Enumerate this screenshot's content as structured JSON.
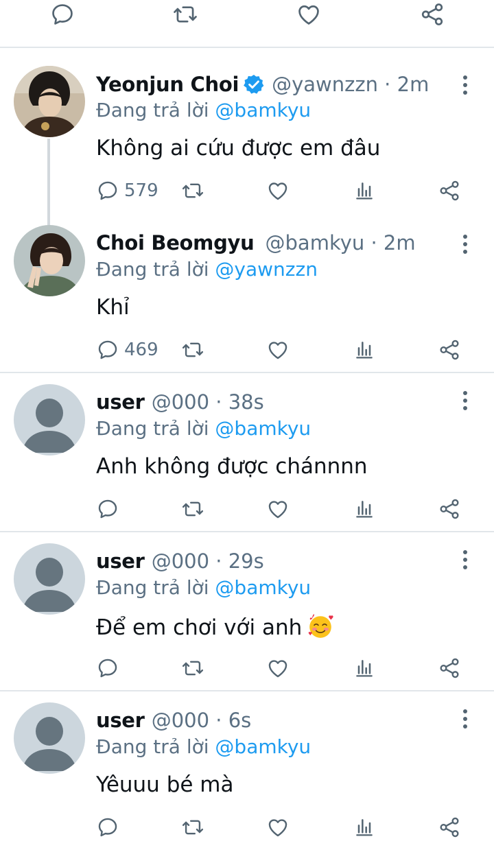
{
  "top_actions": [
    "reply-icon",
    "retweet-icon",
    "like-icon",
    "share-icon"
  ],
  "colors": {
    "link": "#1d9bf0",
    "meta": "#5b7083",
    "icon": "#536471",
    "verified": "#1d9bf0",
    "divider": "#e1e6ea"
  },
  "tweets": [
    {
      "name": "Yeonjun Choi",
      "verified": true,
      "meta": "@yawnzzn · 2m",
      "reply_prefix": "Đang trả lời",
      "reply_handle": "@bamkyu",
      "text": "Không ai cứu được em đâu",
      "reply_count": "579",
      "avatar": "photo-avatar"
    },
    {
      "name": "Choi Beomgyu",
      "verified": false,
      "meta": "@bamkyu · 2m",
      "reply_prefix": "Đang trả lời",
      "reply_handle": "@yawnzzn",
      "text": "Khỉ",
      "reply_count": "469",
      "avatar": "photo-avatar"
    },
    {
      "name": "user",
      "verified": false,
      "meta": "@000 · 38s",
      "reply_prefix": "Đang trả lời",
      "reply_handle": "@bamkyu",
      "text": "Anh không được chánnnn",
      "reply_count": "",
      "avatar": "default-avatar"
    },
    {
      "name": "user",
      "verified": false,
      "meta": "@000 · 29s",
      "reply_prefix": "Đang trả lời",
      "reply_handle": "@bamkyu",
      "text": "Để em chơi với anh",
      "emoji": "smiling-face-with-hearts",
      "reply_count": "",
      "avatar": "default-avatar"
    },
    {
      "name": "user",
      "verified": false,
      "meta": "@000 · 6s",
      "reply_prefix": "Đang trả lời",
      "reply_handle": "@bamkyu",
      "text": "Yêuuu bé mà",
      "reply_count": "",
      "avatar": "default-avatar"
    }
  ]
}
